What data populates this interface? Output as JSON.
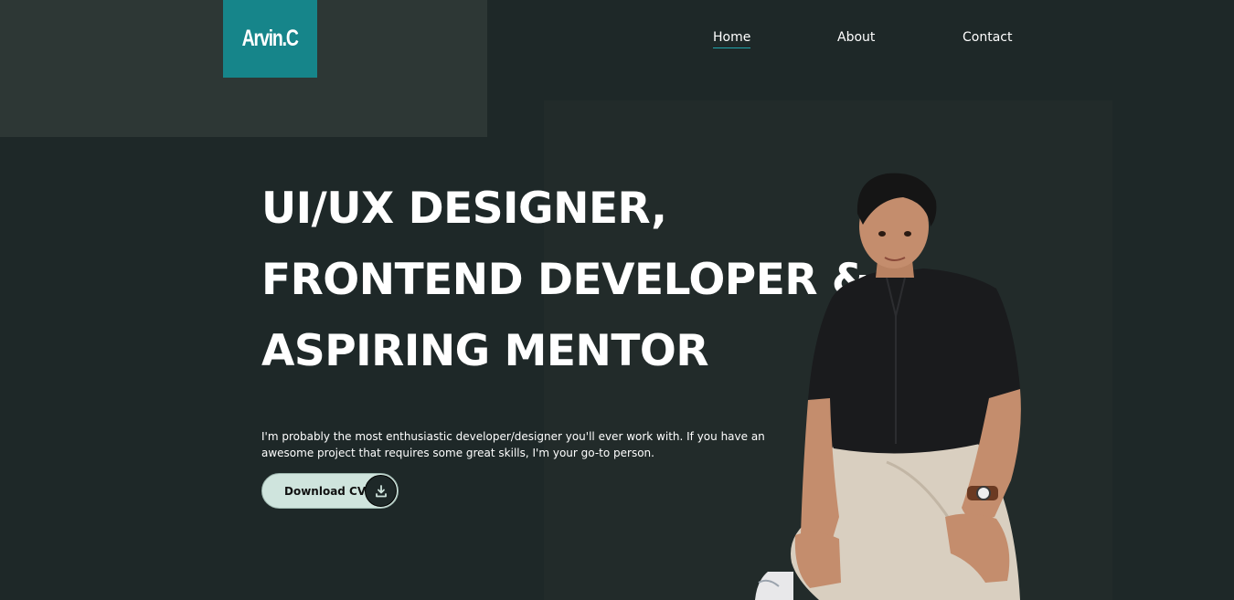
{
  "brand": {
    "logo_text": "Arvin.C",
    "logo_color": "#16858a"
  },
  "nav": {
    "items": [
      {
        "label": "Home",
        "active": true
      },
      {
        "label": "About",
        "active": false
      },
      {
        "label": "Contact",
        "active": false
      }
    ]
  },
  "hero": {
    "headline_lines": [
      "UI/UX DESIGNER,",
      "FRONTEND DEVELOPER &",
      "ASPIRING MENTOR"
    ],
    "description": "I'm probably the most enthusiastic developer/designer you'll ever work with. If you have an awesome project that requires some great skills, I'm your go-to person.",
    "cta_label": "Download CV",
    "cta_icon": "download-icon"
  },
  "colors": {
    "background": "#1e2828",
    "panel": "#2d3735",
    "accent": "#16858a",
    "button": "#cfe4dd"
  }
}
